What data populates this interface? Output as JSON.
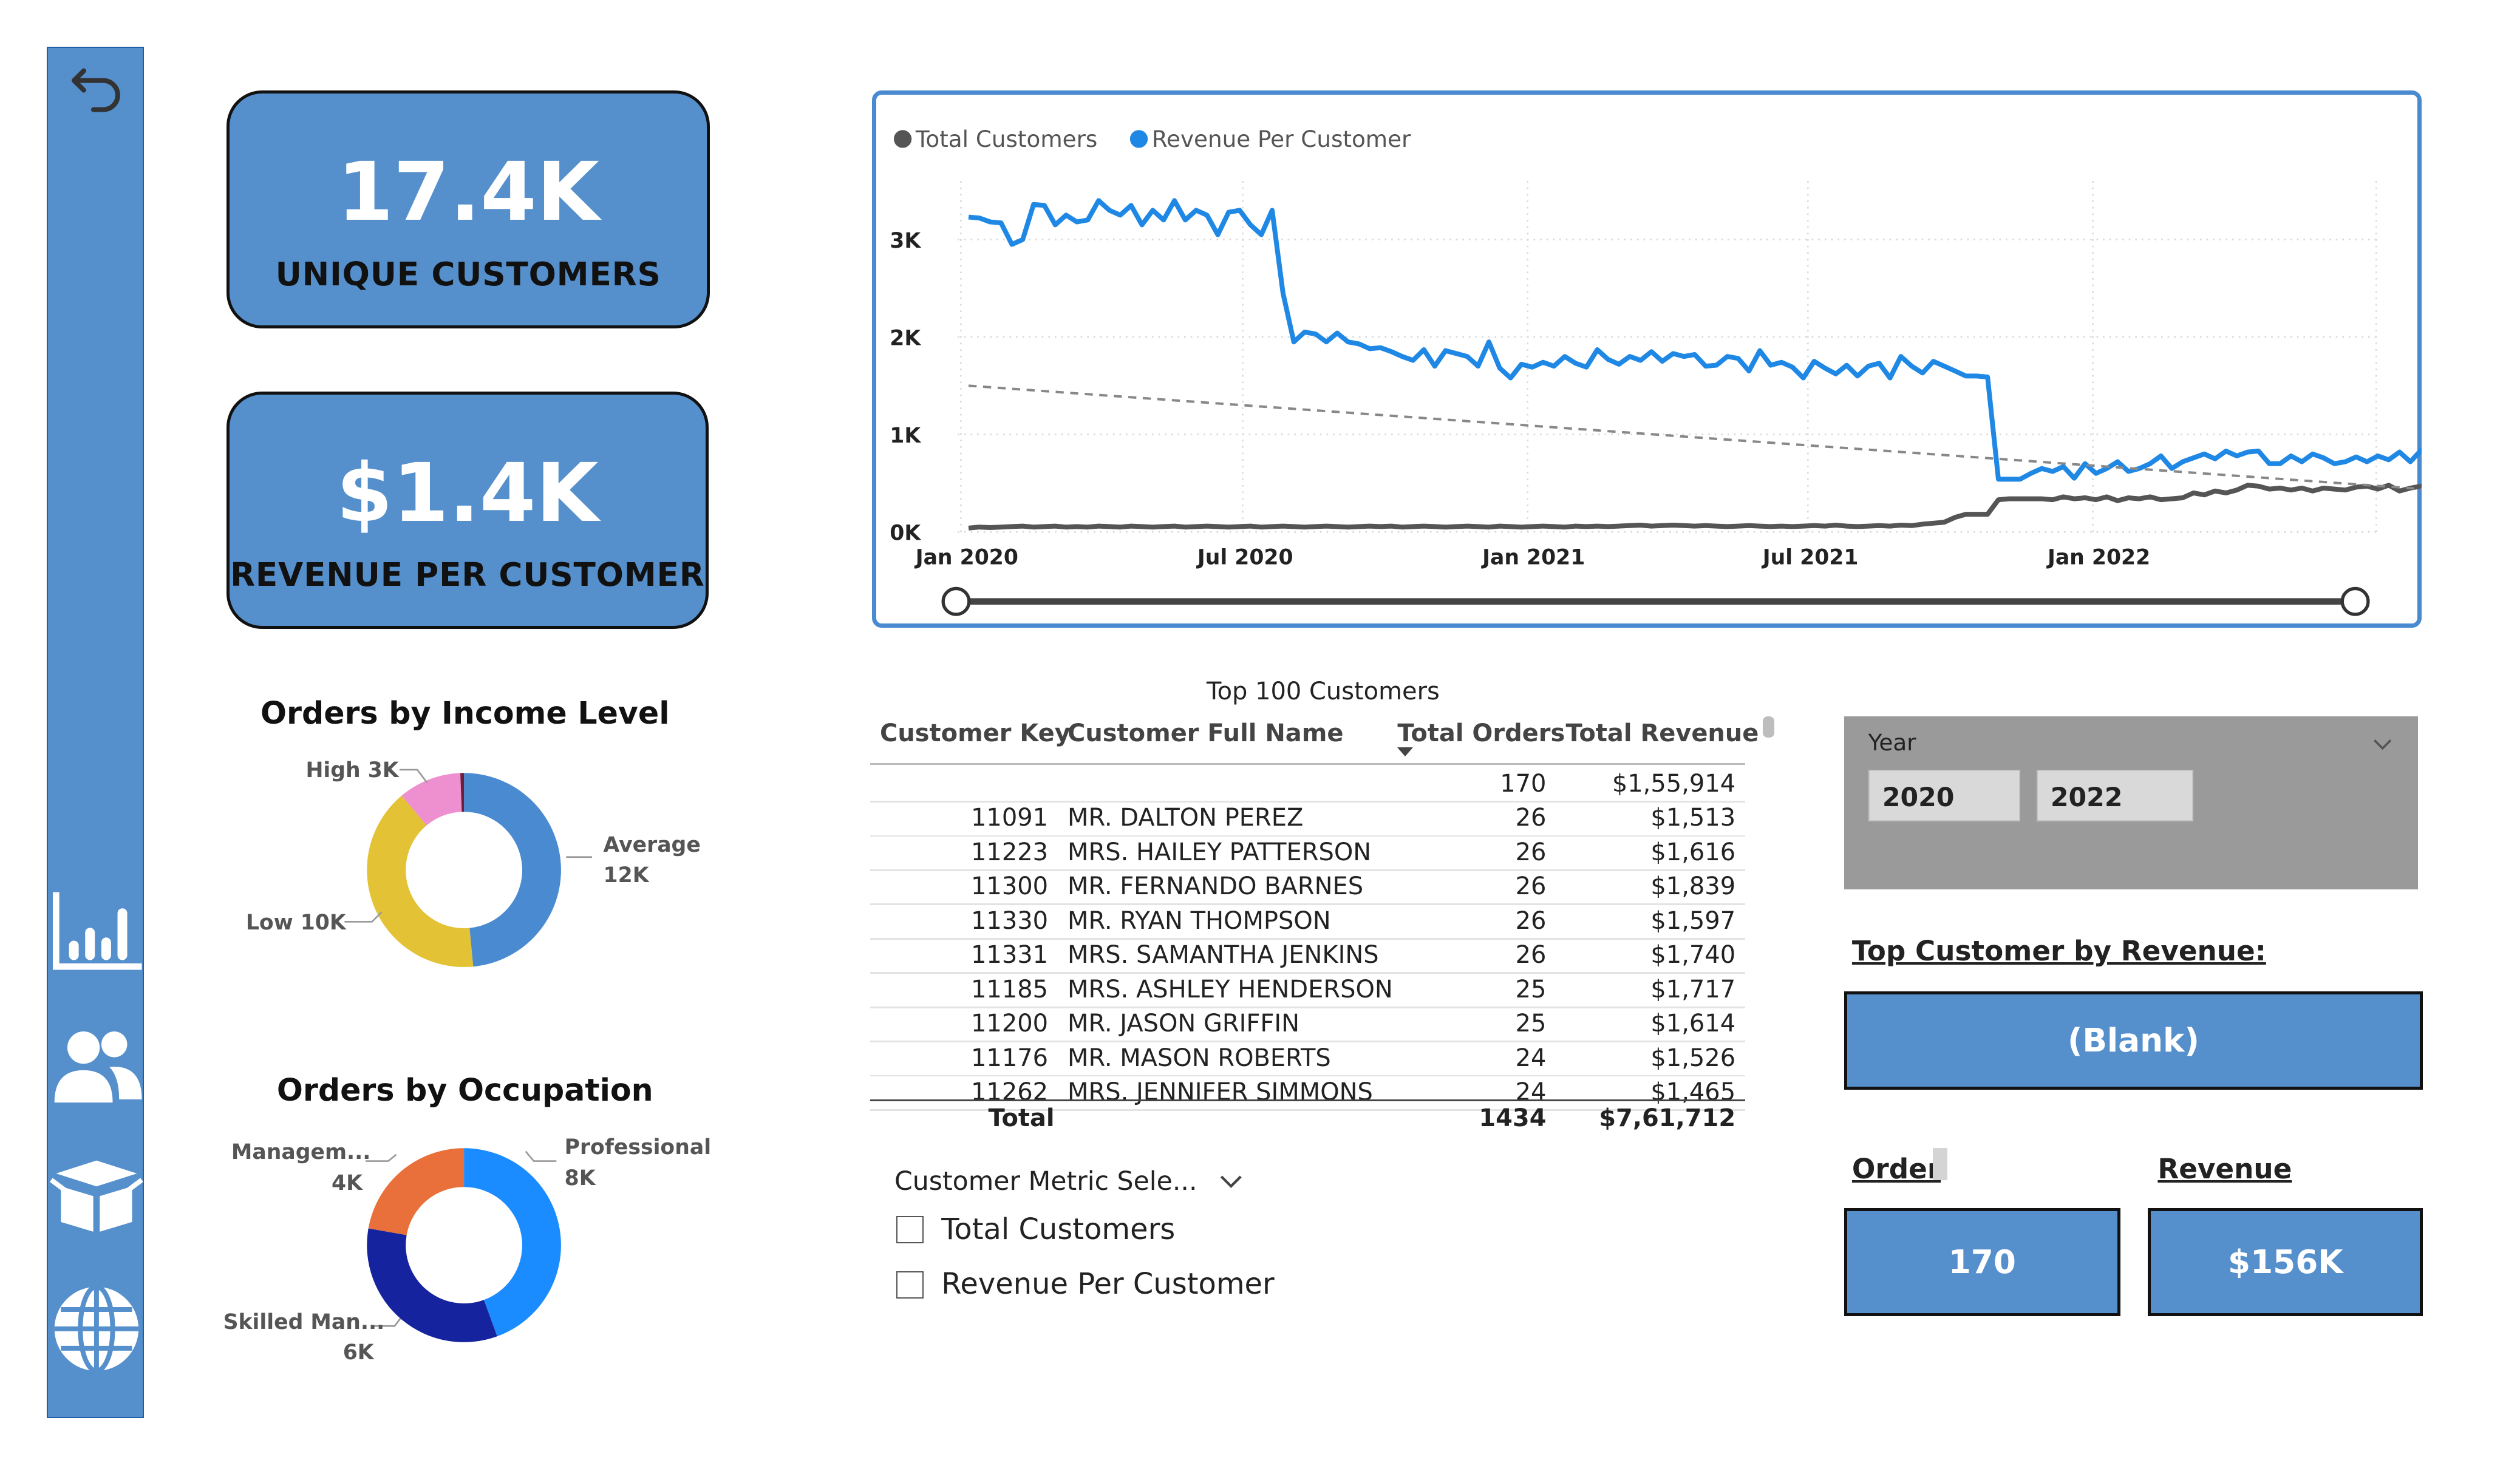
{
  "kpis": {
    "unique_customers": {
      "value": "17.4K",
      "label": "UNIQUE CUSTOMERS"
    },
    "revenue_per_customer": {
      "value": "$1.4K",
      "label": "REVENUE PER CUSTOMER"
    }
  },
  "income_donut": {
    "title": "Orders by Income Level",
    "labels": {
      "high": "High 3K",
      "average_name": "Average",
      "average_value": "12K",
      "low": "Low 10K"
    },
    "segments": [
      {
        "name": "Average",
        "value": 12,
        "color": "#4a8ad0"
      },
      {
        "name": "Low",
        "value": 10,
        "color": "#e3c235"
      },
      {
        "name": "High",
        "value": 2.6,
        "color": "#ee8fcf"
      },
      {
        "name": "Other",
        "value": 0.15,
        "color": "#6b1f3a"
      }
    ]
  },
  "occupation_donut": {
    "title": "Orders by Occupation",
    "labels": {
      "management_name": "Managem...",
      "management_value": "4K",
      "professional_name": "Professional",
      "professional_value": "8K",
      "skilled_name": "Skilled Man...",
      "skilled_value": "6K"
    },
    "segments": [
      {
        "name": "Professional",
        "value": 8,
        "color": "#1a8cff"
      },
      {
        "name": "Skilled Manual",
        "value": 6,
        "color": "#16239e"
      },
      {
        "name": "Management",
        "value": 4,
        "color": "#e9703a"
      }
    ]
  },
  "chart_data": {
    "type": "line",
    "legend": [
      "Total Customers",
      "Revenue Per Customer"
    ],
    "legend_position": "top-left",
    "x_ticks": [
      "Jan 2020",
      "Jul 2020",
      "Jan 2021",
      "Jul 2021",
      "Jan 2022"
    ],
    "y_ticks": [
      "0K",
      "1K",
      "2K",
      "3K"
    ],
    "ylim": [
      0,
      3600
    ],
    "xlim": [
      "2019-12-30",
      "2022-07-03"
    ],
    "grid": true,
    "series": [
      {
        "name": "Revenue Per Customer",
        "color": "#1f88e5",
        "start_week": "2020-01-06",
        "values": [
          3230,
          3220,
          3180,
          3170,
          2950,
          3000,
          3360,
          3350,
          3150,
          3250,
          3180,
          3200,
          3400,
          3300,
          3250,
          3350,
          3150,
          3300,
          3200,
          3400,
          3200,
          3300,
          3250,
          3050,
          3280,
          3300,
          3150,
          3050,
          3300,
          2450,
          1950,
          2050,
          2030,
          1950,
          2040,
          1950,
          1930,
          1880,
          1890,
          1850,
          1800,
          1760,
          1870,
          1700,
          1860,
          1830,
          1800,
          1700,
          1950,
          1680,
          1580,
          1720,
          1690,
          1740,
          1700,
          1800,
          1730,
          1690,
          1870,
          1770,
          1720,
          1800,
          1760,
          1850,
          1750,
          1830,
          1800,
          1820,
          1700,
          1710,
          1800,
          1780,
          1650,
          1860,
          1710,
          1740,
          1690,
          1580,
          1750,
          1680,
          1620,
          1710,
          1600,
          1700,
          1730,
          1580,
          1800,
          1700,
          1630,
          1750,
          1700,
          1650,
          1600,
          1600,
          1590,
          540,
          540,
          540,
          600,
          650,
          620,
          670,
          550,
          700,
          600,
          650,
          720,
          620,
          650,
          700,
          780,
          650,
          720,
          760,
          800,
          750,
          830,
          780,
          820,
          830,
          700,
          700,
          780,
          720,
          800,
          760,
          700,
          720,
          770,
          720,
          780,
          740,
          820,
          720,
          840,
          780,
          800,
          820,
          900,
          780,
          870,
          850,
          900,
          820
        ]
      },
      {
        "name": "Total Customers",
        "color": "#555555",
        "start_week": "2020-01-06",
        "values": [
          40,
          50,
          45,
          50,
          55,
          60,
          50,
          55,
          60,
          50,
          55,
          50,
          60,
          55,
          50,
          60,
          55,
          50,
          55,
          60,
          50,
          55,
          60,
          55,
          50,
          55,
          60,
          50,
          55,
          60,
          55,
          50,
          55,
          60,
          55,
          50,
          55,
          60,
          55,
          60,
          50,
          55,
          60,
          55,
          50,
          55,
          60,
          55,
          50,
          60,
          55,
          50,
          55,
          60,
          55,
          50,
          60,
          55,
          60,
          55,
          60,
          65,
          70,
          60,
          65,
          70,
          65,
          60,
          65,
          60,
          55,
          60,
          65,
          60,
          55,
          60,
          55,
          60,
          65,
          60,
          70,
          60,
          55,
          60,
          65,
          60,
          70,
          65,
          80,
          90,
          100,
          150,
          180,
          180,
          180,
          330,
          340,
          340,
          340,
          340,
          330,
          360,
          340,
          350,
          330,
          360,
          320,
          350,
          340,
          360,
          330,
          340,
          350,
          400,
          380,
          420,
          400,
          430,
          480,
          470,
          440,
          450,
          430,
          450,
          420,
          450,
          440,
          430,
          460,
          470,
          440,
          480,
          420,
          450,
          470,
          500,
          480,
          460,
          470,
          450,
          430,
          500,
          470,
          480,
          380
        ]
      }
    ],
    "trendline": {
      "start": 1500,
      "end": 370
    }
  },
  "table": {
    "title": "Top 100 Customers",
    "headers": [
      "Customer Key",
      "Customer Full Name",
      "Total Orders",
      "Total Revenue"
    ],
    "rows": [
      [
        "",
        "",
        "170",
        "$1,55,914"
      ],
      [
        "11091",
        "MR. DALTON PEREZ",
        "26",
        "$1,513"
      ],
      [
        "11223",
        "MRS. HAILEY PATTERSON",
        "26",
        "$1,616"
      ],
      [
        "11300",
        "MR. FERNANDO BARNES",
        "26",
        "$1,839"
      ],
      [
        "11330",
        "MR. RYAN THOMPSON",
        "26",
        "$1,597"
      ],
      [
        "11331",
        "MRS. SAMANTHA JENKINS",
        "26",
        "$1,740"
      ],
      [
        "11185",
        "MRS. ASHLEY HENDERSON",
        "25",
        "$1,717"
      ],
      [
        "11200",
        "MR. JASON GRIFFIN",
        "25",
        "$1,614"
      ],
      [
        "11176",
        "MR. MASON ROBERTS",
        "24",
        "$1,526"
      ],
      [
        "11262",
        "MRS. JENNIFER SIMMONS",
        "24",
        "$1,465"
      ]
    ],
    "total": {
      "label": "Total",
      "orders": "1434",
      "revenue": "$7,61,712"
    }
  },
  "metric_selector": {
    "title": "Customer Metric Sele...",
    "options": [
      "Total Customers",
      "Revenue Per Customer"
    ]
  },
  "year_slicer": {
    "label": "Year",
    "values": [
      "2020",
      "2022"
    ]
  },
  "top_customer": {
    "title": "Top Customer by Revenue:",
    "value": "(Blank)"
  },
  "order_card": {
    "title": "Order",
    "value": "170"
  },
  "revenue_card": {
    "title": "Revenue",
    "value": "$156K"
  },
  "colors": {
    "accent": "#5590cc",
    "chart_border": "#4a8ad0",
    "slicer_bg": "#9a9a9a"
  }
}
